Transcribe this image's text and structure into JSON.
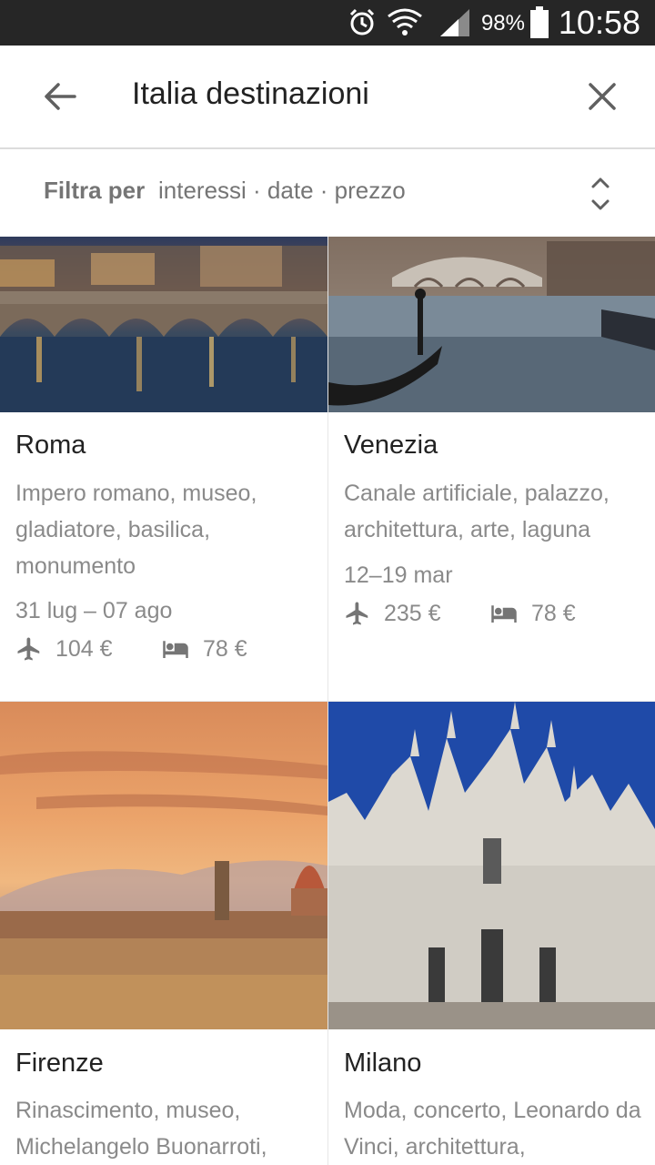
{
  "status_bar": {
    "battery_percent": "98%",
    "time": "10:58",
    "icons": [
      "alarm-icon",
      "wifi-icon",
      "signal-icon",
      "battery-icon"
    ]
  },
  "app_bar": {
    "back_icon": "arrow-back-icon",
    "title": "Italia destinazioni",
    "close_icon": "close-icon"
  },
  "filter": {
    "label": "Filtra per",
    "values": "interessi · date · prezzo",
    "toggle_icon": "expand-collapse-icon"
  },
  "destinations": [
    {
      "name": "Roma",
      "tags": "Impero romano, museo, gladiatore, basilica, monumento",
      "dates": "31 lug – 07 ago",
      "flight_price": "104 €",
      "hotel_price": "78 €",
      "image": "Rome riverside bridge at dusk"
    },
    {
      "name": "Venezia",
      "tags": "Canale artificiale, palazzo, architettura, arte, laguna",
      "dates": "12–19 mar",
      "flight_price": "235 €",
      "hotel_price": "78 €",
      "image": "Venice gondola and Rialto bridge"
    },
    {
      "name": "Firenze",
      "tags": "Rinascimento, museo, Michelangelo Buonarroti,",
      "image": "Florence skyline at sunset"
    },
    {
      "name": "Milano",
      "tags": "Moda, concerto, Leonardo da Vinci, architettura,",
      "image": "Milan cathedral facade"
    }
  ],
  "colors": {
    "status_bar": "#262626",
    "text_primary": "#222222",
    "text_secondary": "#8a8a8a",
    "divider": "#e6e6e6"
  }
}
